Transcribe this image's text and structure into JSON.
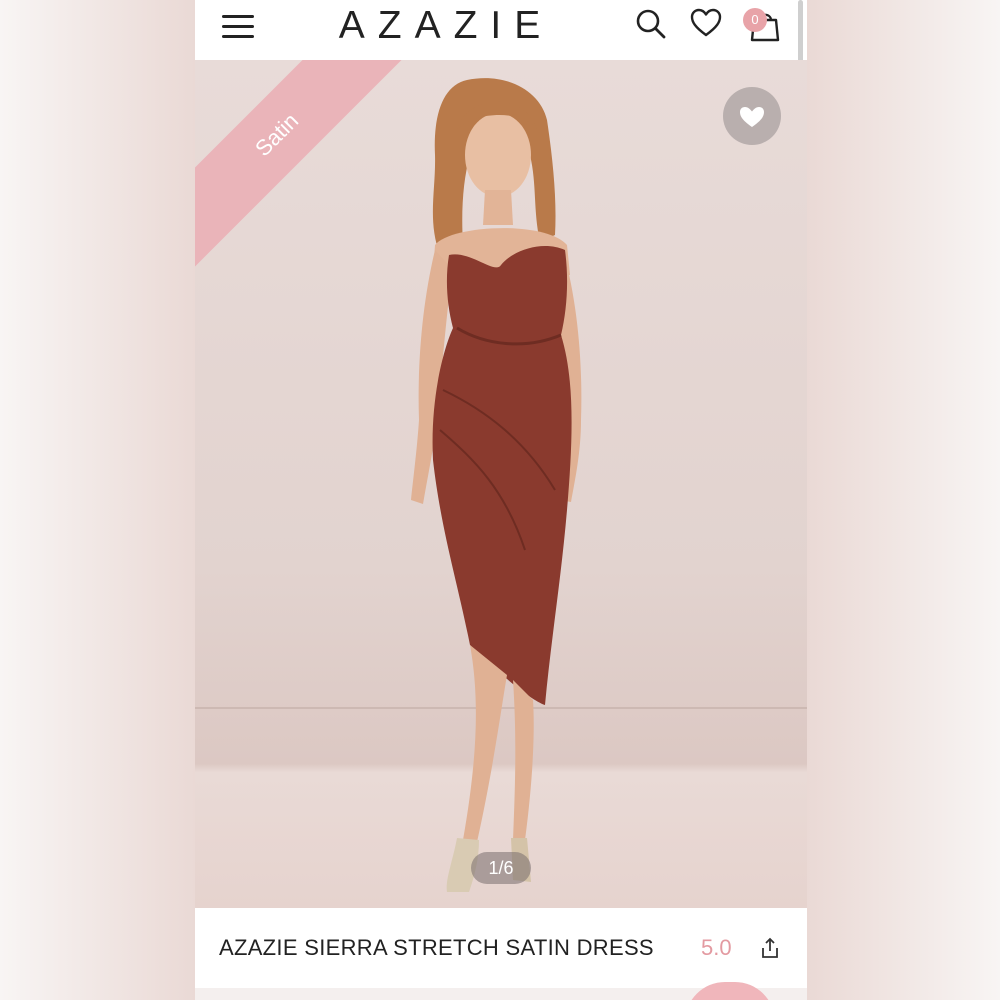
{
  "header": {
    "logo": "AZAZIE",
    "cart_count": "0"
  },
  "hero": {
    "badge": "Satin",
    "image_counter": "1/6"
  },
  "product": {
    "title": "AZAZIE SIERRA STRETCH SATIN DRESS",
    "rating": "5.0"
  },
  "icons": {
    "menu": "menu-icon",
    "search": "search-icon",
    "wishlist": "heart-icon",
    "cart": "bag-icon",
    "favorite": "heart-icon",
    "share": "share-icon"
  },
  "colors": {
    "accent": "#e39aa1",
    "badge": "#eab4b9",
    "dress": "#8a3a2e"
  }
}
